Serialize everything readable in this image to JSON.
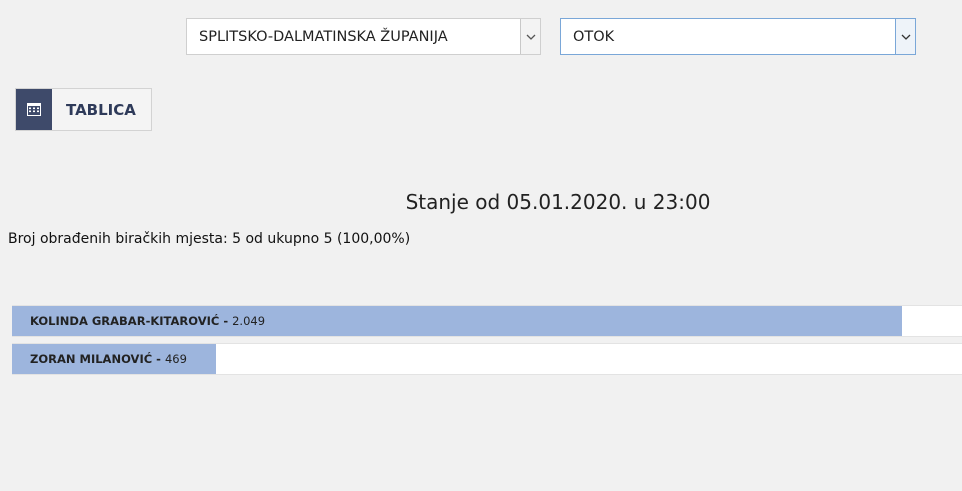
{
  "filters": {
    "county": {
      "selected": "SPLITSKO-DALMATINSKA ŽUPANIJA"
    },
    "area": {
      "selected": "OTOK"
    }
  },
  "table_button": {
    "label": "TABLICA",
    "icon": "calendar-grid-icon"
  },
  "status": {
    "title": "Stanje od 05.01.2020. u 23:00",
    "processed": "Broj obrađenih biračkih mjesta: 5 od ukupno 5 (100,00%)"
  },
  "results": {
    "max_votes": 2187,
    "candidates": [
      {
        "name": "KOLINDA GRABAR-KITAROVIĆ",
        "votes_label": "2.049",
        "votes": 2049
      },
      {
        "name": "ZORAN MILANOVIĆ",
        "votes_label": "469",
        "votes": 469
      }
    ]
  },
  "colors": {
    "bar_fill": "#9db5dd",
    "button_icon_bg": "#3e4a6a",
    "select_focus_border": "#7aa7d8"
  }
}
